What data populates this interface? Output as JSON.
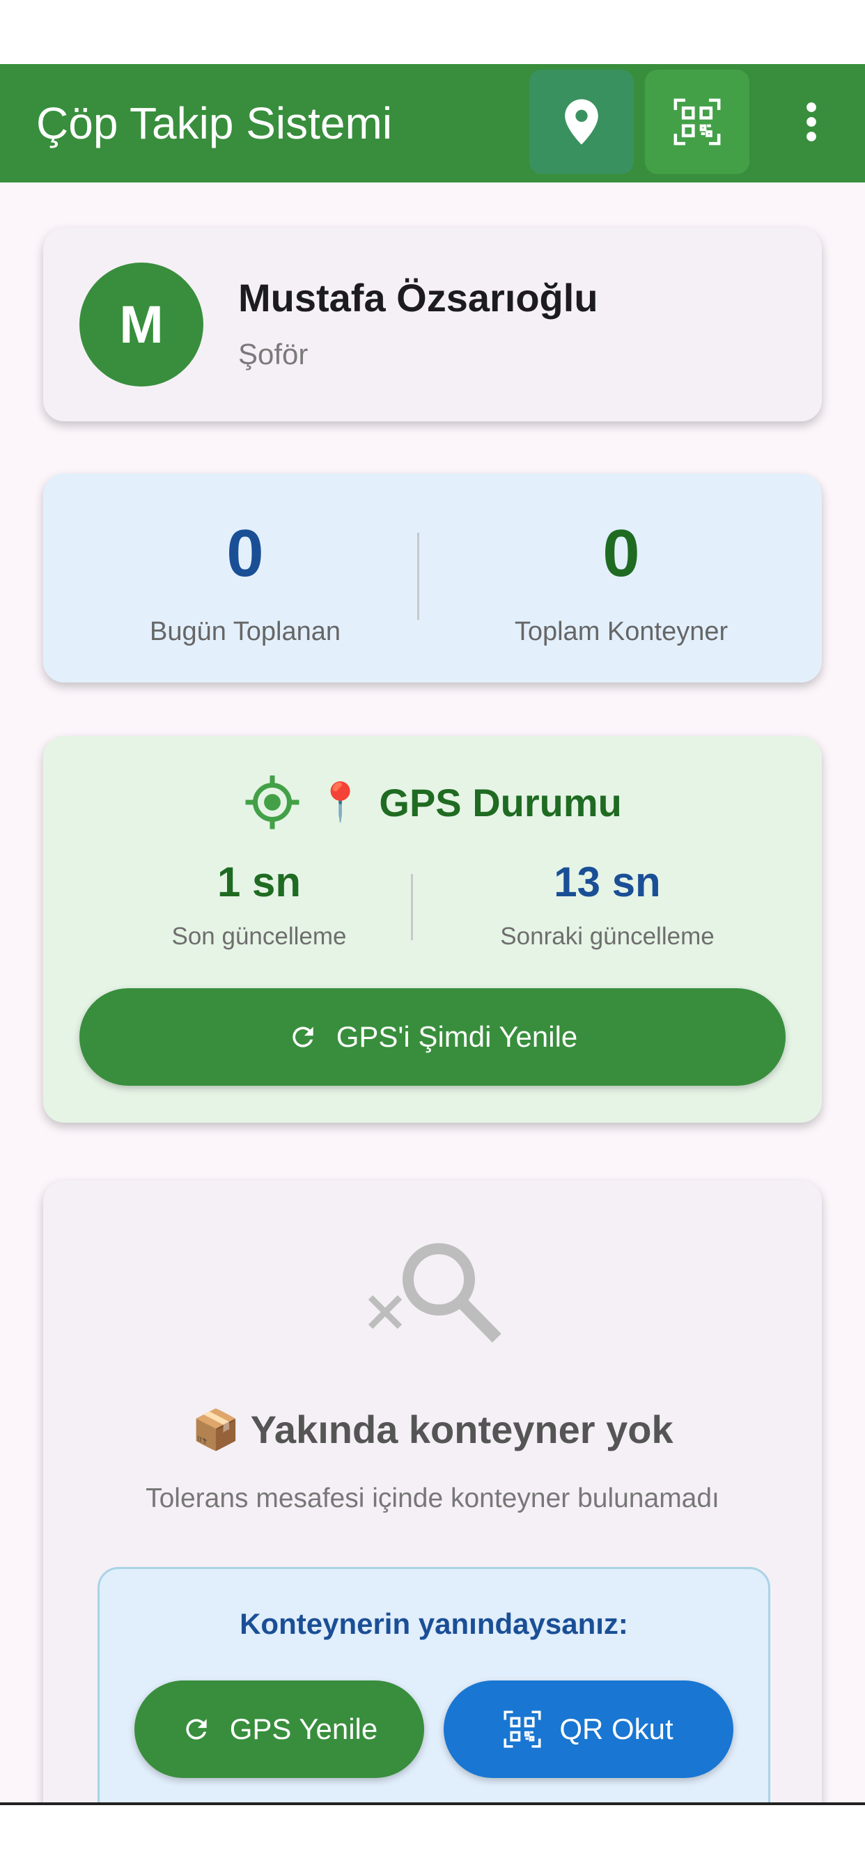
{
  "appbar": {
    "title": "Çöp Takip Sistemi",
    "icons": [
      "location-pin-icon",
      "qr-scan-icon",
      "more-vert-icon"
    ]
  },
  "profile": {
    "avatar_letter": "M",
    "name": "Mustafa Özsarıoğlu",
    "role": "Şoför"
  },
  "stats": {
    "collected_today_value": "0",
    "collected_today_label": "Bugün Toplanan",
    "total_containers_value": "0",
    "total_containers_label": "Toplam Konteyner"
  },
  "gps": {
    "pin_emoji": "📍",
    "title": "GPS Durumu",
    "last_update_value": "1 sn",
    "last_update_label": "Son güncelleme",
    "next_update_value": "13 sn",
    "next_update_label": "Sonraki güncelleme",
    "refresh_button_label": "GPS'i Şimdi Yenile"
  },
  "empty_state": {
    "box_emoji": "📦",
    "title": "Yakında konteyner yok",
    "subtitle": "Tolerans mesafesi içinde konteyner bulunamadı",
    "hint_title": "Konteynerin yanındaysanız:",
    "gps_refresh_label": "GPS Yenile",
    "qr_scan_label": "QR Okut"
  },
  "colors": {
    "primary_green": "#388e3c",
    "dark_green": "#1f6b22",
    "dark_blue": "#1a4f96",
    "accent_blue": "#1976d2",
    "stats_bg": "#e3f0fc",
    "gps_bg": "#e6f4e6"
  }
}
